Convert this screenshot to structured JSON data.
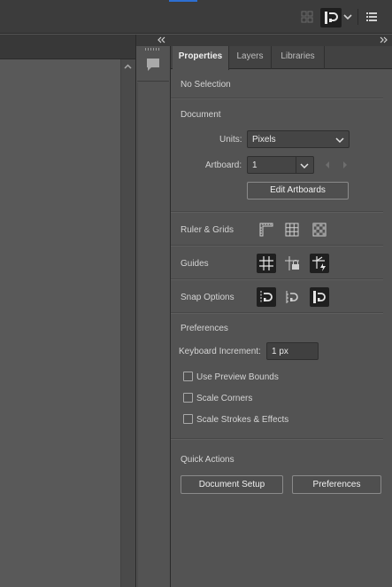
{
  "panel": {
    "tabs": [
      {
        "label": "Properties",
        "active": true
      },
      {
        "label": "Layers",
        "active": false
      },
      {
        "label": "Libraries",
        "active": false
      }
    ],
    "selection_status": "No Selection"
  },
  "document": {
    "heading": "Document",
    "units_label": "Units:",
    "units_value": "Pixels",
    "artboard_label": "Artboard:",
    "artboard_value": "1",
    "edit_artboards_label": "Edit Artboards"
  },
  "ruler_grids": {
    "label": "Ruler & Grids",
    "icons": [
      "ruler-icon",
      "grid-icon",
      "transparency-grid-icon"
    ]
  },
  "guides": {
    "label": "Guides",
    "icons": [
      "show-guides-icon",
      "lock-guides-icon",
      "smart-guides-icon"
    ]
  },
  "snap_options": {
    "label": "Snap Options",
    "icons": [
      "snap-to-point-icon",
      "snap-to-grid-icon",
      "snap-to-pixel-icon"
    ]
  },
  "preferences": {
    "heading": "Preferences",
    "keyboard_increment_label": "Keyboard Increment:",
    "keyboard_increment_value": "1 px",
    "checkboxes": [
      {
        "label": "Use Preview Bounds",
        "checked": false
      },
      {
        "label": "Scale Corners",
        "checked": false
      },
      {
        "label": "Scale Strokes & Effects",
        "checked": false
      }
    ]
  },
  "quick_actions": {
    "heading": "Quick Actions",
    "document_setup_label": "Document Setup",
    "preferences_label": "Preferences"
  },
  "colors": {
    "panel_bg": "#535353",
    "accent": "#2d6fd1",
    "active_icon_bg": "#1f1f1f"
  }
}
